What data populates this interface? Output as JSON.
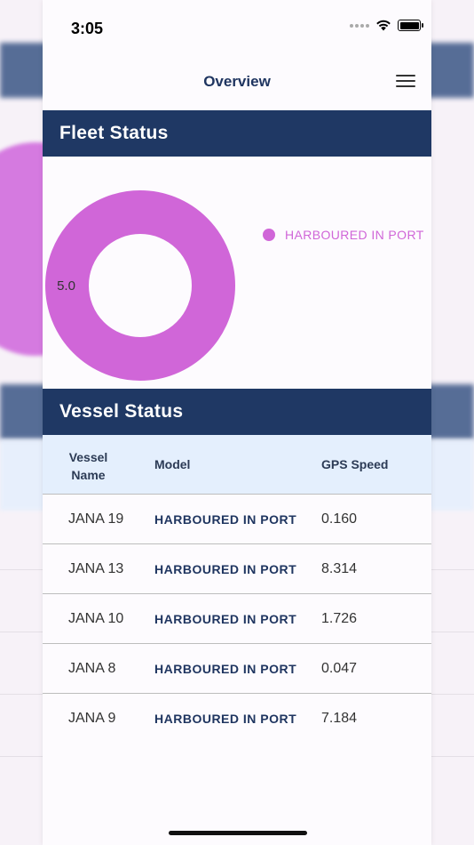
{
  "status_bar": {
    "time": "3:05"
  },
  "nav": {
    "title": "Overview",
    "menu_icon": "hamburger-menu-icon"
  },
  "fleet_status": {
    "title": "Fleet Status"
  },
  "chart_data": {
    "type": "pie",
    "categories": [
      "HARBOURED IN PORT"
    ],
    "values": [
      5.0
    ],
    "value_labels": [
      "5.0"
    ],
    "colors": [
      "#d066d8"
    ],
    "legend_placement": "right"
  },
  "vessel_status": {
    "title": "Vessel Status",
    "columns": [
      "Vessel Name",
      "Model",
      "GPS Speed"
    ],
    "rows": [
      {
        "name": "JANA 19",
        "model": "HARBOURED IN PORT",
        "speed": "0.160"
      },
      {
        "name": "JANA 13",
        "model": "HARBOURED IN PORT",
        "speed": "8.314"
      },
      {
        "name": "JANA 10",
        "model": "HARBOURED IN PORT",
        "speed": "1.726"
      },
      {
        "name": "JANA 8",
        "model": "HARBOURED IN PORT",
        "speed": "0.047"
      },
      {
        "name": "JANA 9",
        "model": "HARBOURED IN PORT",
        "speed": "7.184"
      }
    ]
  },
  "colors": {
    "header_bg": "#1f3864",
    "table_header_bg": "#e4effd",
    "accent": "#d066d8"
  }
}
